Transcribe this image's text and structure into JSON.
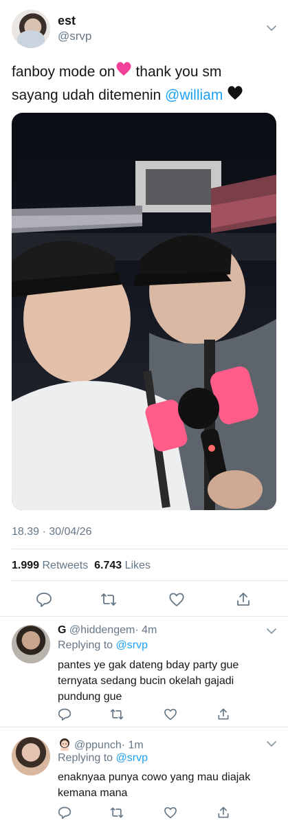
{
  "tweet": {
    "author_name": "est",
    "author_handle": "@srvp",
    "text_line1_a": "fanboy mode on",
    "text_line1_b": " thank you sm",
    "text_line2_a": "sayang udah ditemenin ",
    "text_line2_mention": "@william",
    "timestamp": "18.39 · 30/04/26",
    "retweets_count": "1.999",
    "retweets_label": "Retweets",
    "likes_count": "6.743",
    "likes_label": "Likes"
  },
  "replies": [
    {
      "name": "G",
      "handle": "@hiddengem",
      "time": "· 4m",
      "replying_prefix": "Replying to ",
      "replying_to": "@srvp",
      "text": "pantes ye gak dateng bday party gue ternyata sedang bucin okelah gajadi pundung gue"
    },
    {
      "name": "",
      "handle": "@ppunch",
      "time": "· 1m",
      "replying_prefix": "Replying to ",
      "replying_to": "@srvp",
      "text": "enaknyaa punya cowo yang mau diajak kemana mana"
    }
  ],
  "colors": {
    "accent": "#1da1f2",
    "secondary_text": "#657786",
    "divider": "#e1e8ed"
  },
  "icons": [
    "chevron-down-icon",
    "pink-heart-emoji",
    "black-heart-emoji",
    "reply-icon",
    "retweet-icon",
    "like-icon",
    "share-icon"
  ]
}
